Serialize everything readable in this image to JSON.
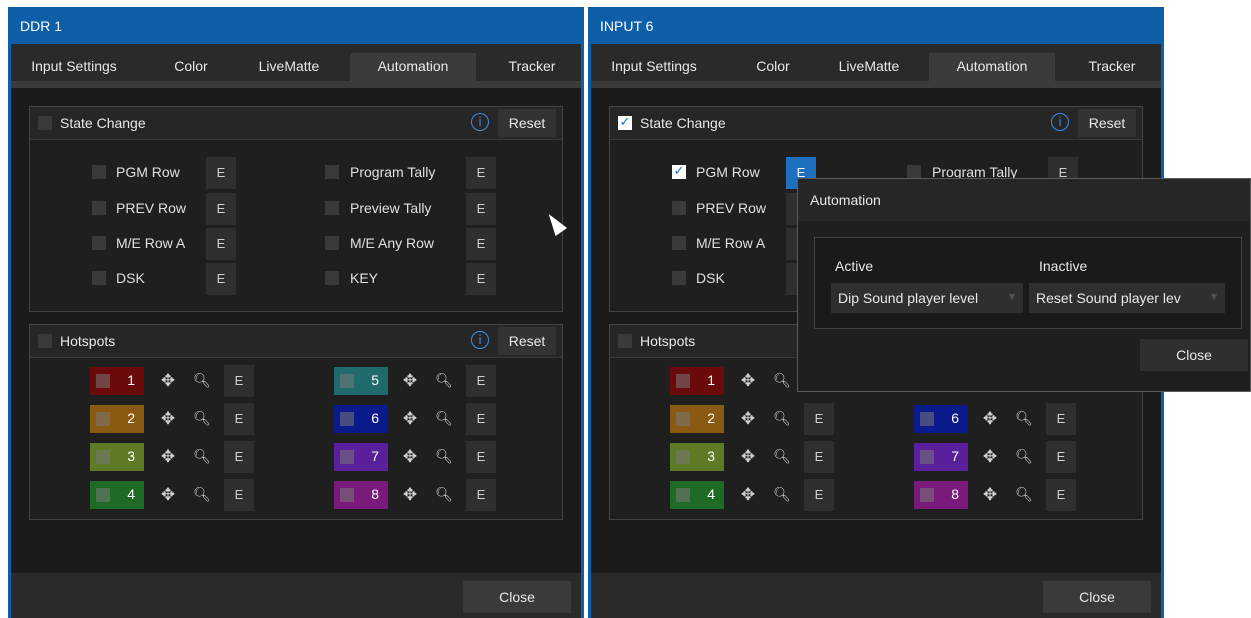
{
  "left": {
    "title": "DDR 1",
    "tabs": [
      "Input Settings",
      "Color",
      "LiveMatte",
      "Automation",
      "Tracker"
    ],
    "state_change": {
      "title": "State Change",
      "info": "i",
      "reset": "Reset",
      "checked": false,
      "left_rows": [
        "PGM Row",
        "PREV Row",
        "M/E Row A",
        "DSK"
      ],
      "right_rows": [
        "Program Tally",
        "Preview Tally",
        "M/E Any Row",
        "KEY"
      ],
      "e": "E"
    },
    "hotspots": {
      "title": "Hotspots",
      "info": "i",
      "reset": "Reset",
      "numbers": [
        "1",
        "2",
        "3",
        "4",
        "5",
        "6",
        "7",
        "8"
      ],
      "colors": [
        "#6b0a0a",
        "#8a5a12",
        "#5f7a24",
        "#1f6a24",
        "#1f6a6a",
        "#0b1a8a",
        "#5a1f9a",
        "#7a1a7a"
      ],
      "move_icon": "move-icon",
      "zoom_icon": "zoom-icon",
      "e": "E"
    },
    "close": "Close"
  },
  "right": {
    "title": "INPUT 6",
    "tabs": [
      "Input Settings",
      "Color",
      "LiveMatte",
      "Automation",
      "Tracker"
    ],
    "state_change": {
      "title": "State Change",
      "info": "i",
      "reset": "Reset",
      "checked": true,
      "left_rows": [
        "PGM Row",
        "PREV Row",
        "M/E Row A",
        "DSK"
      ],
      "pgm_checked": true,
      "right_rows_visible": [
        "Program Tally"
      ],
      "e": "E"
    },
    "hotspots": {
      "title": "Hotspots",
      "numbers": [
        "1",
        "2",
        "3",
        "4",
        "6",
        "7",
        "8"
      ],
      "e": "E"
    },
    "close": "Close"
  },
  "popup": {
    "title": "Automation",
    "active_label": "Active",
    "inactive_label": "Inactive",
    "active_value": "Dip Sound player level",
    "inactive_value": "Reset Sound player lev",
    "close": "Close"
  },
  "accent": "#1d6fc0",
  "titlebar_color": "#0f5fa8"
}
